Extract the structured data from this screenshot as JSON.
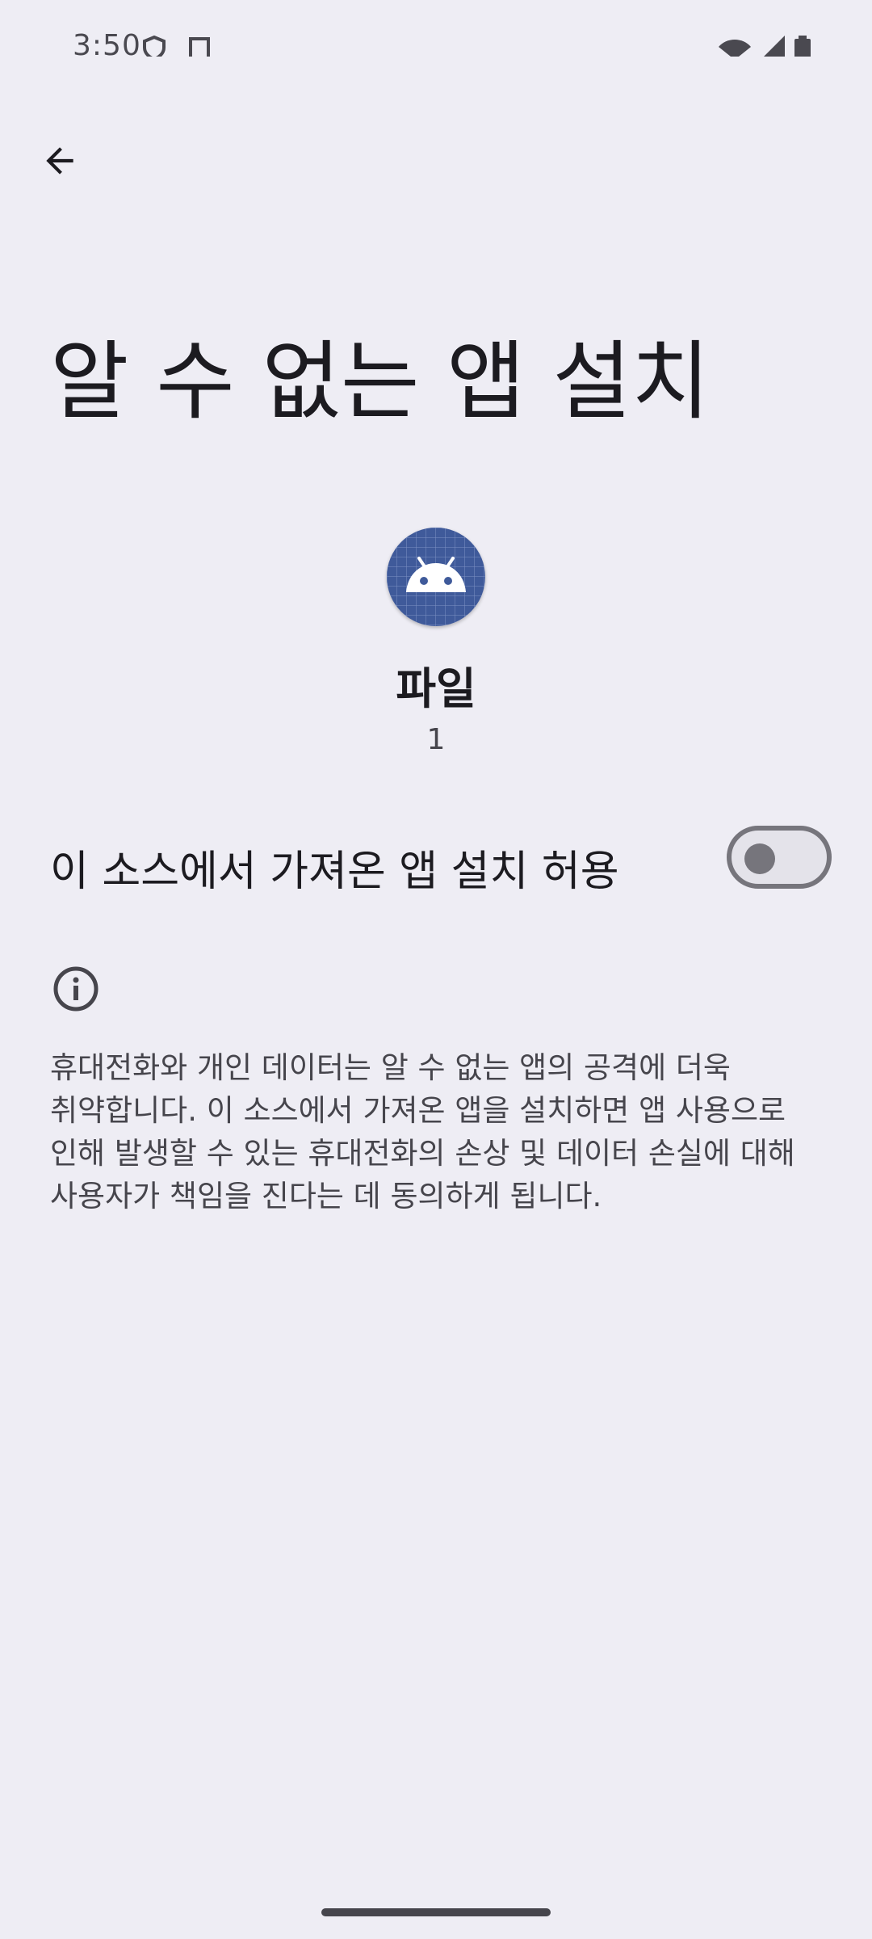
{
  "status_bar": {
    "time": "3:50",
    "left_icons": [
      "shield-icon",
      "screenshot-icon"
    ],
    "right_icons": [
      "wifi-icon",
      "signal-icon",
      "battery-icon"
    ]
  },
  "header": {
    "back_icon": "arrow-back-icon"
  },
  "page": {
    "title": "알 수 없는 앱 설치"
  },
  "app": {
    "icon": "android-icon",
    "icon_color": "#3f5a9a",
    "name": "파일",
    "version": "1"
  },
  "allow_setting": {
    "label": "이 소스에서 가져온 앱 설치 허용",
    "enabled": false
  },
  "info": {
    "icon": "info-icon",
    "text": "휴대전화와 개인 데이터는 알 수 없는 앱의 공격에 더욱 취약합니다. 이 소스에서 가져온 앱을 설치하면 앱 사용으로 인해 발생할 수 있는 휴대전화의 손상 및 데이터 손실에 대해 사용자가 책임을 진다는 데 동의하게 됩니다."
  },
  "colors": {
    "background": "#eeedf4",
    "primary_text": "#1c1b20",
    "secondary_text": "#46454c",
    "toggle_outline": "#76757c"
  }
}
